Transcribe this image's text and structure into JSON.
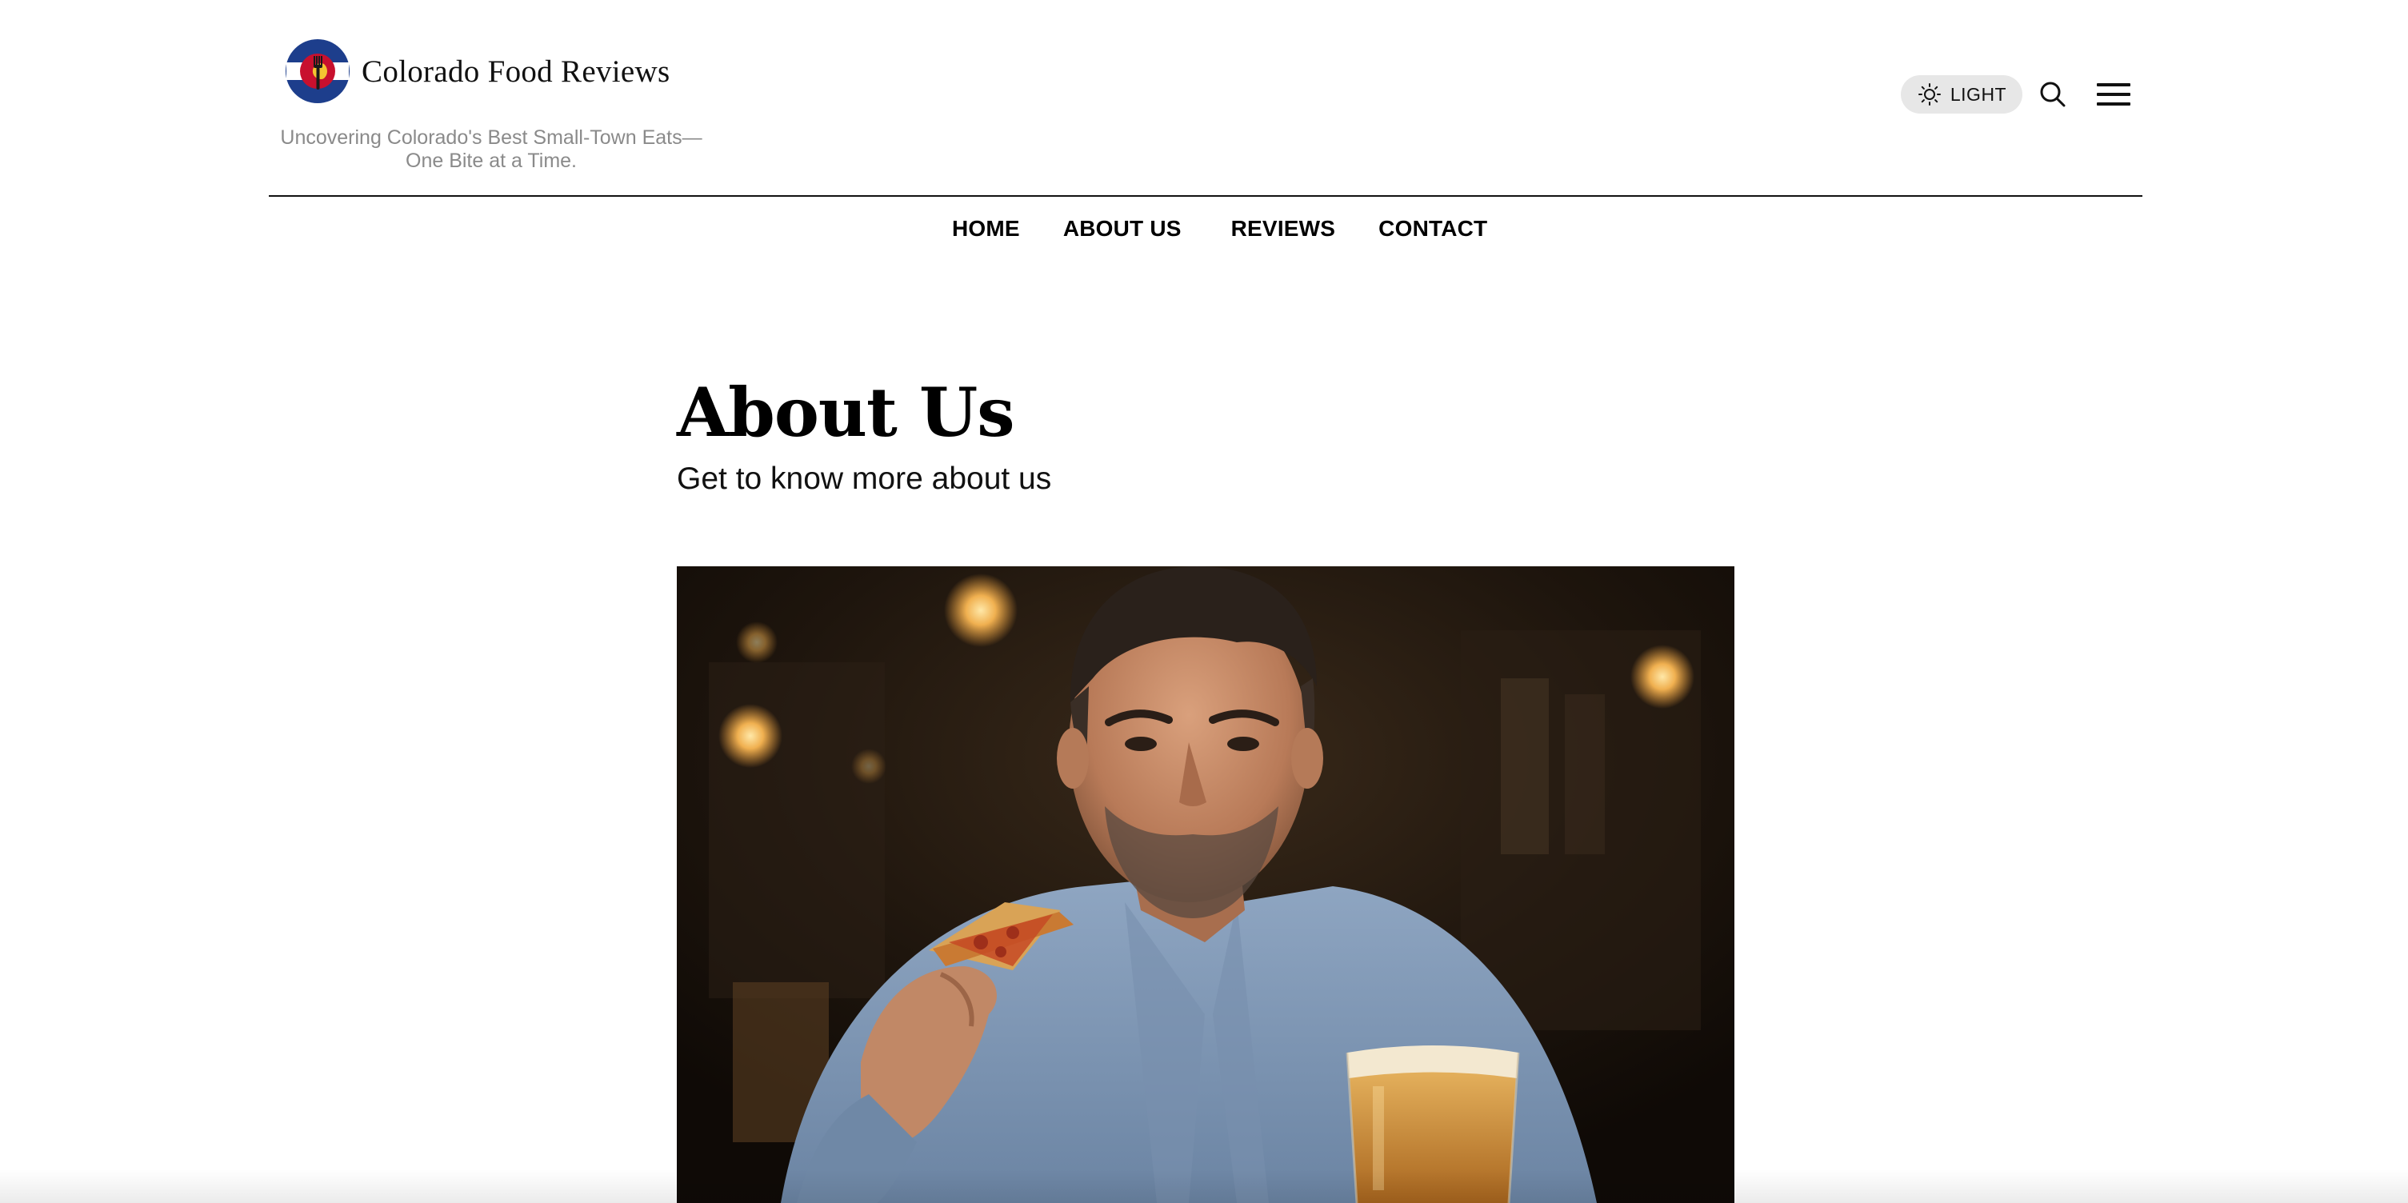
{
  "site": {
    "title": "Colorado Food Reviews",
    "tagline": "Uncovering Colorado's Best Small-Town Eats—One Bite at a Time.",
    "logo_icon": "colorado-flag-fork-icon"
  },
  "header": {
    "theme_toggle_label": "LIGHT",
    "theme_icon": "sun-icon",
    "search_icon": "search-icon",
    "menu_icon": "hamburger-menu-icon"
  },
  "nav": {
    "items": [
      {
        "label": "HOME"
      },
      {
        "label": "ABOUT US"
      },
      {
        "label": "REVIEWS"
      },
      {
        "label": "CONTACT"
      }
    ]
  },
  "hero": {
    "title": "About Us",
    "subtitle": "Get to know more about us",
    "image_alt": "Man eating a slice of pepperoni pizza with a glass of beer in a dimly lit restaurant"
  },
  "colors": {
    "flag_blue": "#1d3e8c",
    "flag_red": "#c8102e",
    "flag_gold": "#f4c531",
    "toggle_bg": "#e7e7e7",
    "tagline_gray": "#8a8a8a"
  }
}
